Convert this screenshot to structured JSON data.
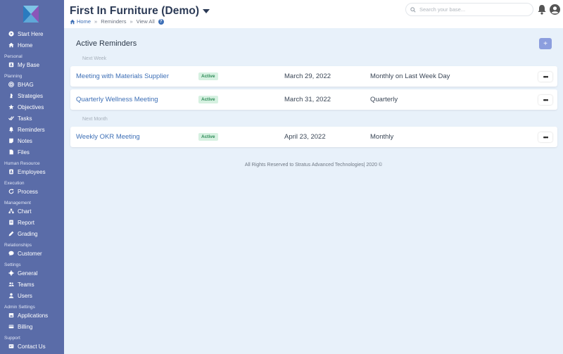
{
  "sidebar": {
    "items": [
      {
        "type": "item",
        "label": "Start Here",
        "icon": "play-circle-icon"
      },
      {
        "type": "item",
        "label": "Home",
        "icon": "home-icon"
      },
      {
        "type": "section",
        "label": "Personal"
      },
      {
        "type": "item",
        "label": "My Base",
        "icon": "user-card-icon"
      },
      {
        "type": "section",
        "label": "Planning"
      },
      {
        "type": "item",
        "label": "BHAG",
        "icon": "target-icon"
      },
      {
        "type": "item",
        "label": "Strategies",
        "icon": "chess-icon"
      },
      {
        "type": "item",
        "label": "Objectives",
        "icon": "star-icon"
      },
      {
        "type": "item",
        "label": "Tasks",
        "icon": "check-double-icon"
      },
      {
        "type": "item",
        "label": "Reminders",
        "icon": "bell-icon"
      },
      {
        "type": "item",
        "label": "Notes",
        "icon": "note-icon"
      },
      {
        "type": "item",
        "label": "Files",
        "icon": "file-icon"
      },
      {
        "type": "section",
        "label": "Human Resource"
      },
      {
        "type": "item",
        "label": "Employees",
        "icon": "id-badge-icon"
      },
      {
        "type": "section",
        "label": "Execution"
      },
      {
        "type": "item",
        "label": "Process",
        "icon": "refresh-icon"
      },
      {
        "type": "section",
        "label": "Management"
      },
      {
        "type": "item",
        "label": "Chart",
        "icon": "org-chart-icon"
      },
      {
        "type": "item",
        "label": "Report",
        "icon": "report-icon"
      },
      {
        "type": "item",
        "label": "Grading",
        "icon": "pen-icon"
      },
      {
        "type": "section",
        "label": "Relationships"
      },
      {
        "type": "item",
        "label": "Customer",
        "icon": "chat-icon"
      },
      {
        "type": "section",
        "label": "Settings"
      },
      {
        "type": "item",
        "label": "General",
        "icon": "gear-icon"
      },
      {
        "type": "item",
        "label": "Teams",
        "icon": "users-icon"
      },
      {
        "type": "item",
        "label": "Users",
        "icon": "user-icon"
      },
      {
        "type": "section",
        "label": "Admin Settings"
      },
      {
        "type": "item",
        "label": "Applications",
        "icon": "apps-icon"
      },
      {
        "type": "item",
        "label": "Billing",
        "icon": "billing-icon"
      },
      {
        "type": "section",
        "label": "Support"
      },
      {
        "type": "item",
        "label": "Contact Us",
        "icon": "phone-icon"
      }
    ]
  },
  "header": {
    "title": "First In Furniture (Demo)",
    "breadcrumb": {
      "home": "Home",
      "reminders": "Reminders",
      "view_all": "View All",
      "sep": "»"
    },
    "search_placeholder": "Search your base..."
  },
  "main": {
    "title": "Active Reminders",
    "add_label": "+",
    "groups": [
      {
        "label": "Next Week",
        "reminders": [
          {
            "name": "Meeting with Materials Supplier",
            "status": "Active",
            "date": "March 29, 2022",
            "frequency": "Monthly on Last Week Day"
          },
          {
            "name": "Quarterly Wellness Meeting",
            "status": "Active",
            "date": "March 31, 2022",
            "frequency": "Quarterly"
          }
        ]
      },
      {
        "label": "Next Month",
        "reminders": [
          {
            "name": "Weekly OKR Meeting",
            "status": "Active",
            "date": "April 23, 2022",
            "frequency": "Monthly"
          }
        ]
      }
    ],
    "more_label": "•••"
  },
  "footer": {
    "text": "All Rights Reserved to Stratus Advanced Technologies| 2020 ©"
  },
  "colors": {
    "sidebar": "#5a6ca8",
    "accent": "#3d6fb6",
    "active_badge": "#2e8b57",
    "background": "#e8f1fa"
  }
}
